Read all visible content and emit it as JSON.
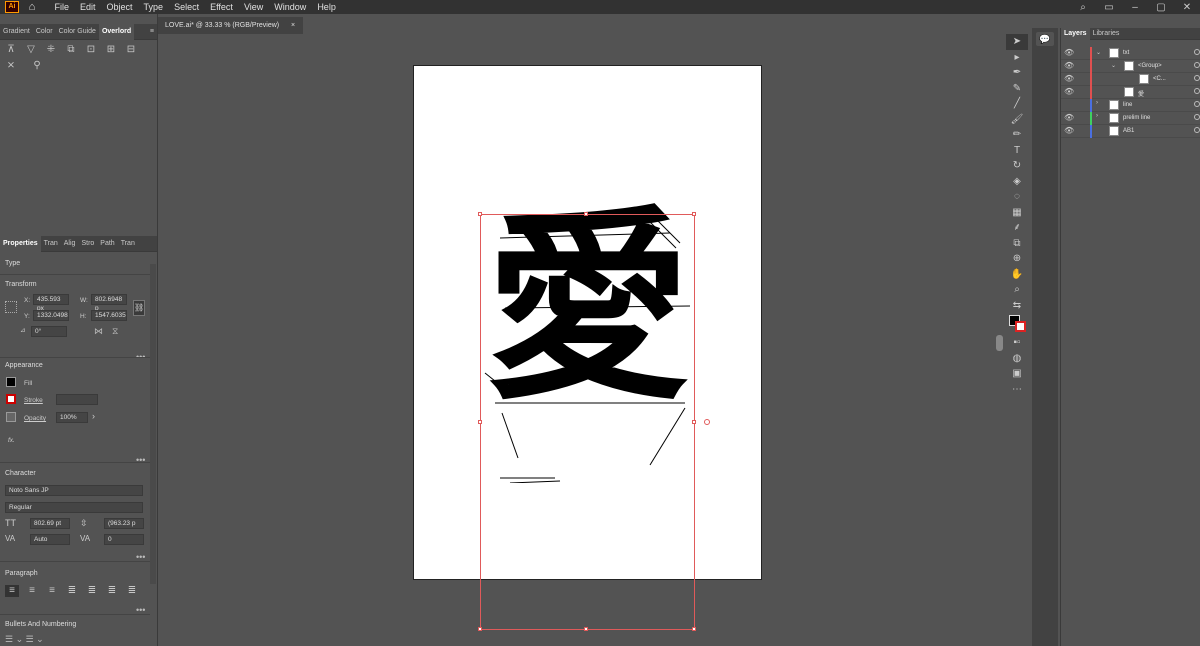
{
  "app": {
    "logo": "Ai",
    "home_icon": "home-icon"
  },
  "menu": [
    "File",
    "Edit",
    "Object",
    "Type",
    "Select",
    "Effect",
    "View",
    "Window",
    "Help"
  ],
  "top_panel": {
    "tabs": [
      "Gradient",
      "Color",
      "Color Guide",
      "Overlord"
    ],
    "active_tab": "Overlord"
  },
  "document_tab": {
    "title": "LOVE.ai* @ 33.33 % (RGB/Preview)",
    "close": "×"
  },
  "properties": {
    "tabs": [
      "Properties",
      "Tran",
      "Alig",
      "Stro",
      "Path",
      "Tran"
    ],
    "selection_type": "Type",
    "transform": {
      "title": "Transform",
      "x_label": "X:",
      "x": "435.593 px",
      "y_label": "Y:",
      "y": "1332.0498",
      "w_label": "W:",
      "w": "802.6948 p",
      "h_label": "H:",
      "h": "1547.6035",
      "angle": "0°"
    },
    "appearance": {
      "title": "Appearance",
      "fill_label": "Fill",
      "stroke_label": "Stroke",
      "opacity_label": "Opacity",
      "opacity_value": "100%",
      "fx_label": "fx."
    },
    "character": {
      "title": "Character",
      "font_family": "Noto Sans JP",
      "font_style": "Regular",
      "font_size": "802.69 pt",
      "leading": "(963.23 p",
      "kerning": "Auto",
      "tracking": "0"
    },
    "paragraph": {
      "title": "Paragraph"
    },
    "bullets": {
      "title": "Bullets And Numbering"
    }
  },
  "canvas": {
    "glyph": "愛"
  },
  "layers_panel": {
    "tabs": [
      "Layers",
      "Libraries"
    ],
    "rows": [
      {
        "name": "txt",
        "color": "#e05050",
        "visible": true
      },
      {
        "name": "<Group>",
        "color": "#e05050",
        "visible": true
      },
      {
        "name": "<C...",
        "color": "#e05050",
        "visible": true
      },
      {
        "name": "愛",
        "color": "#e05050",
        "visible": true
      },
      {
        "name": "line",
        "color": "#4a6fe0",
        "visible": false
      },
      {
        "name": "prelim line",
        "color": "#3fd060",
        "visible": true
      },
      {
        "name": "AB1",
        "color": "#4a6fe0",
        "visible": true
      }
    ]
  }
}
